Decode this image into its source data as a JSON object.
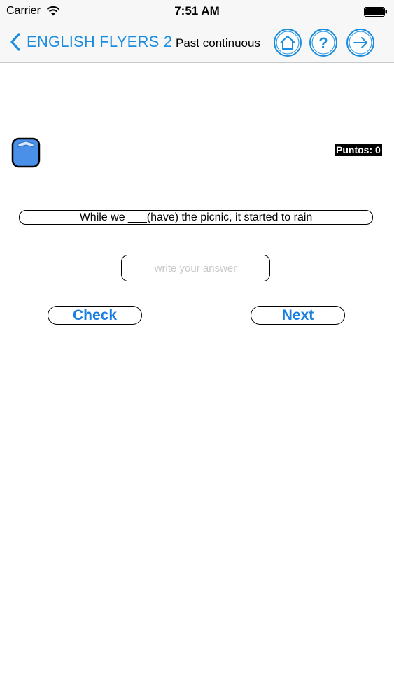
{
  "status_bar": {
    "carrier": "Carrier",
    "time": "7:51 AM"
  },
  "nav": {
    "back_label": "ENGLISH FLYERS 2",
    "title": "Past continuous",
    "icons": [
      "home-icon",
      "help-icon",
      "arrow-right-icon"
    ]
  },
  "quiz": {
    "score_label": "Puntos: 0",
    "question": "While we ___(have) the picnic, it started to rain",
    "answer_value": "",
    "answer_placeholder": "write your answer",
    "check_label": "Check",
    "next_label": "Next"
  },
  "colors": {
    "accent": "#1a8de0",
    "button_text": "#1a7fe0",
    "lock_fill": "#4a8fe8",
    "background": "#ffffff",
    "bar_background": "#f7f7f7"
  }
}
